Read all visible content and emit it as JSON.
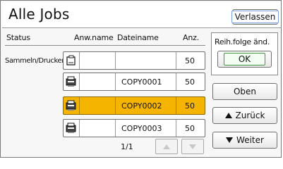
{
  "title": "Alle Jobs",
  "exit_label": "Verlassen",
  "columns": {
    "status": "Status",
    "user_name": "Anw.name",
    "file_name": "Dateiname",
    "quantity": "Anz."
  },
  "status_value": "Sammeln/Drucken",
  "jobs": [
    {
      "user_name": "",
      "file_name": "",
      "quantity": "50",
      "icon": "printer-doc-icon",
      "selected": false
    },
    {
      "user_name": "",
      "file_name": "COPY0001",
      "quantity": "50",
      "icon": "copier-icon",
      "selected": false
    },
    {
      "user_name": "",
      "file_name": "COPY0002",
      "quantity": "50",
      "icon": "copier-icon",
      "selected": true
    },
    {
      "user_name": "",
      "file_name": "COPY0003",
      "quantity": "50",
      "icon": "copier-icon",
      "selected": false
    }
  ],
  "page_indicator": "1/1",
  "order_panel": {
    "label": "Reih.folge änd.",
    "ok_label": "OK"
  },
  "buttons": {
    "top": "Oben",
    "back": "Zurück",
    "next": "Weiter"
  },
  "colors": {
    "selected_row": "#f5b400",
    "ok_border": "#3f9a3f",
    "exit_border": "#7b9fd8"
  }
}
